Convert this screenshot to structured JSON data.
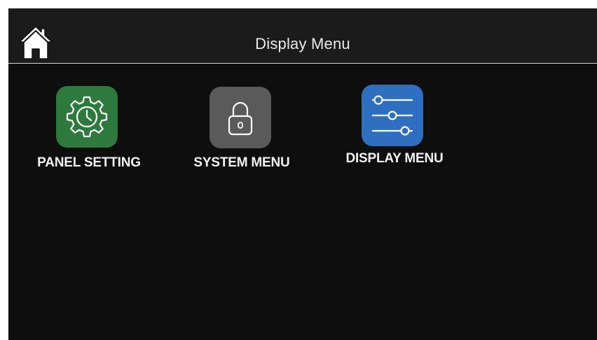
{
  "header": {
    "title": "Display Menu",
    "home_icon": "home-icon"
  },
  "menu": {
    "items": [
      {
        "label": "PANEL SETTING",
        "icon": "gear-clock-icon",
        "color": "#2d7a3c"
      },
      {
        "label": "SYSTEM MENU",
        "icon": "padlock-icon",
        "color": "#5a5a5a"
      },
      {
        "label": "DISPLAY MENU",
        "icon": "sliders-icon",
        "color": "#2f6fbf"
      }
    ]
  },
  "colors": {
    "background": "#0e0e0e",
    "header_background": "#1b1b1b",
    "text": "#f2f2f2"
  }
}
